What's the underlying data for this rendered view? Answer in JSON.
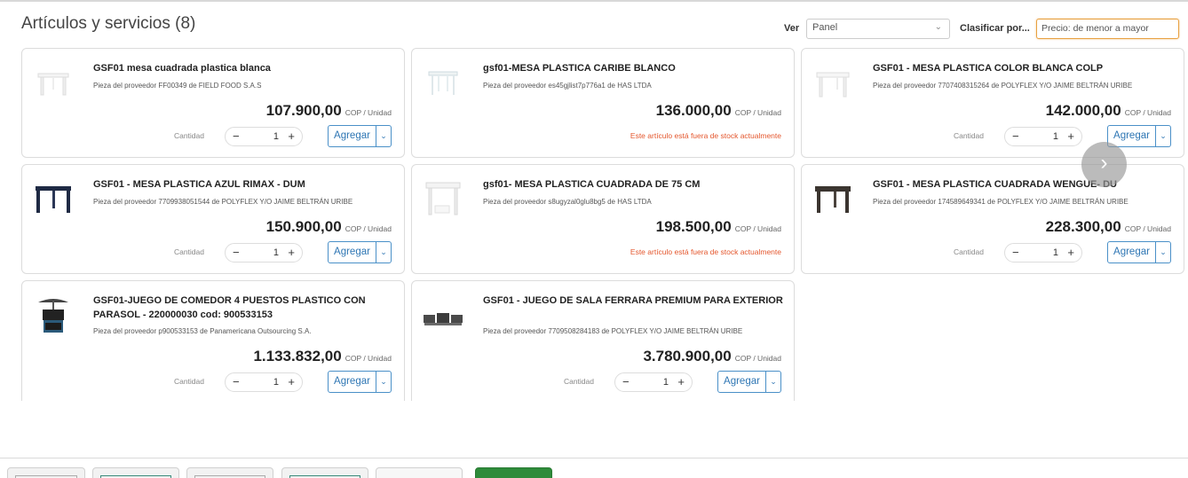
{
  "header": {
    "title": "Artículos y servicios (8)",
    "view_label": "Ver",
    "view_value": "Panel",
    "sort_label": "Clasificar por...",
    "sort_value": "Precio: de menor a mayor"
  },
  "common": {
    "qty_label": "Cantidad",
    "add_label": "Agregar",
    "minus": "−",
    "plus": "+",
    "caret": "⌄",
    "next": "›",
    "out_of_stock": "Este artículo está fuera de stock actualmente"
  },
  "products": [
    {
      "name": "GSF01 mesa cuadrada plastica blanca",
      "supplier": "Pieza del proveedor FF00349 de FIELD FOOD S.A.S",
      "price": "107.900,00",
      "unit": "COP / Unidad",
      "qty": "1",
      "in_stock": true,
      "thumb": "white-table"
    },
    {
      "name": "gsf01-MESA PLASTICA CARIBE BLANCO",
      "supplier": "Pieza del proveedor es45gjlist7p776a1 de HAS LTDA",
      "price": "136.000,00",
      "unit": "COP / Unidad",
      "qty": "1",
      "in_stock": false,
      "thumb": "white-table-light"
    },
    {
      "name": "GSF01 - MESA PLASTICA COLOR BLANCA COLP",
      "supplier": "Pieza del proveedor 7707408315264 de POLYFLEX Y/O JAIME BELTRÁN URIBE",
      "price": "142.000,00",
      "unit": "COP / Unidad",
      "qty": "1",
      "in_stock": true,
      "thumb": "white-table"
    },
    {
      "name": "GSF01 - MESA PLASTICA AZUL RIMAX - DUM",
      "supplier": "Pieza del proveedor 7709938051544 de POLYFLEX Y/O JAIME BELTRÁN URIBE",
      "price": "150.900,00",
      "unit": "COP / Unidad",
      "qty": "1",
      "in_stock": true,
      "thumb": "navy-table"
    },
    {
      "name": "gsf01- MESA PLASTICA CUADRADA DE 75 CM",
      "supplier": "Pieza del proveedor s8ugyzal0glu8bg5 de HAS LTDA",
      "price": "198.500,00",
      "unit": "COP / Unidad",
      "qty": "1",
      "in_stock": false,
      "thumb": "white-table-tall"
    },
    {
      "name": "GSF01 - MESA PLASTICA CUADRADA WENGUE- DU",
      "supplier": "Pieza del proveedor 174589649341 de POLYFLEX Y/O JAIME BELTRÁN URIBE",
      "price": "228.300,00",
      "unit": "COP / Unidad",
      "qty": "1",
      "in_stock": true,
      "thumb": "dark-table"
    },
    {
      "name": "GSF01-JUEGO DE COMEDOR 4 PUESTOS PLASTICO CON PARASOL - 220000030 cod: 900533153",
      "supplier": "Pieza del proveedor p900533153 de Panamericana Outsourcing S.A.",
      "price": "1.133.832,00",
      "unit": "COP / Unidad",
      "qty": "1",
      "in_stock": true,
      "thumb": "dining-set"
    },
    {
      "name": "GSF01 - JUEGO DE SALA FERRARA PREMIUM PARA EXTERIOR",
      "supplier": "Pieza del proveedor 7709508284183 de POLYFLEX Y/O JAIME BELTRÁN URIBE",
      "price": "3.780.900,00",
      "unit": "COP / Unidad",
      "qty": "1",
      "in_stock": true,
      "thumb": "sofa-set"
    }
  ],
  "colors": {
    "accent_blue": "#2e76b4",
    "out_of_stock": "#e4572e",
    "sort_border": "#e8a040"
  }
}
